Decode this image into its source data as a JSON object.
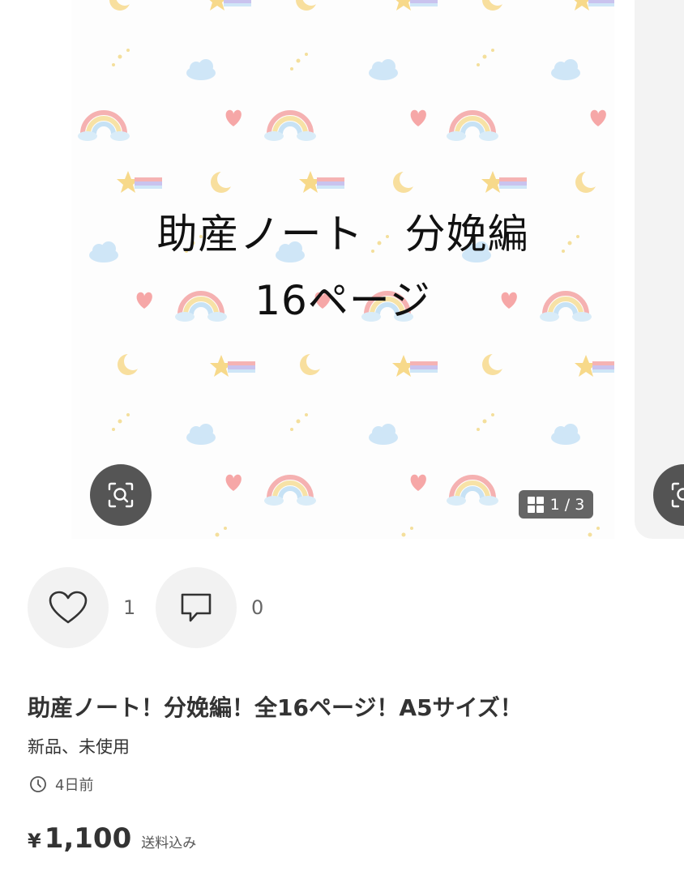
{
  "image": {
    "overlay_line1": "助産ノート　分娩編",
    "overlay_line2": "16ページ",
    "counter": "1 / 3"
  },
  "actions": {
    "like_count": "1",
    "comment_count": "0"
  },
  "item": {
    "title": "助産ノート！分娩編！全16ページ！A5サイズ！",
    "condition": "新品、未使用",
    "posted": "4日前",
    "price_symbol": "¥",
    "price": "1,100",
    "shipping": "送料込み"
  },
  "icons": {
    "zoom": "scan-search-icon",
    "gallery": "grid-icon",
    "like": "heart-icon",
    "comment": "comment-icon",
    "clock": "clock-icon"
  },
  "colors": {
    "icon_button_bg": "#f2f2f2",
    "overlay_button_bg": "#464646",
    "text": "#333333"
  }
}
